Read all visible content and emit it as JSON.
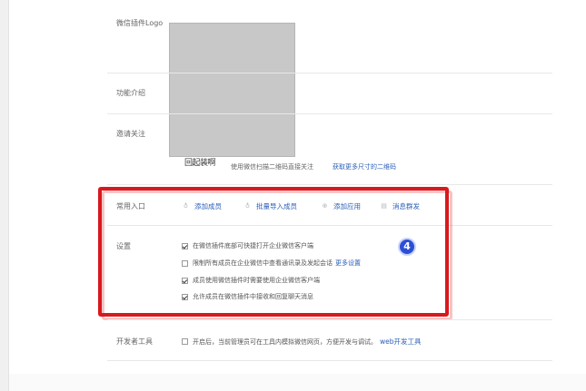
{
  "labels": {
    "logo": "微信插件Logo",
    "intro": "功能介绍",
    "invite": "邀请关注",
    "entry": "常用入口",
    "settings": "设置",
    "dev_tools": "开发者工具"
  },
  "qr": {
    "caption": "回起装啊",
    "help_text": "使用微信扫描二维码直接关注",
    "more_link": "获取更多尺寸的二维码"
  },
  "entries": [
    {
      "label": "添加成员",
      "icon": "person-icon"
    },
    {
      "label": "批量导入成员",
      "icon": "people-icon"
    },
    {
      "label": "添加应用",
      "icon": "plus-circle-icon"
    },
    {
      "label": "消息群发",
      "icon": "message-icon"
    }
  ],
  "settings": [
    {
      "text": "在微信插件底部可快捷打开企业微信客户端",
      "checked": true,
      "link": ""
    },
    {
      "text": "限制所有成员在企业微信中查看通讯录及发起会话",
      "checked": false,
      "link": "更多设置"
    },
    {
      "text": "成员使用微信插件时需要使用企业微信客户端",
      "checked": true,
      "link": ""
    },
    {
      "text": "允许成员在微信插件中接收和回复聊天消息",
      "checked": true,
      "link": ""
    }
  ],
  "step_badge": "4",
  "dev": {
    "text": "开启后，当前管理员可在工具内模拟微信网页，方便开发与调试。",
    "link": "web开发工具",
    "checked": false
  },
  "colors": {
    "highlight": "#d8191d",
    "link": "#2b5fb8",
    "badge": "#2d4fd6",
    "qr_placeholder": "#c8c8c8"
  }
}
